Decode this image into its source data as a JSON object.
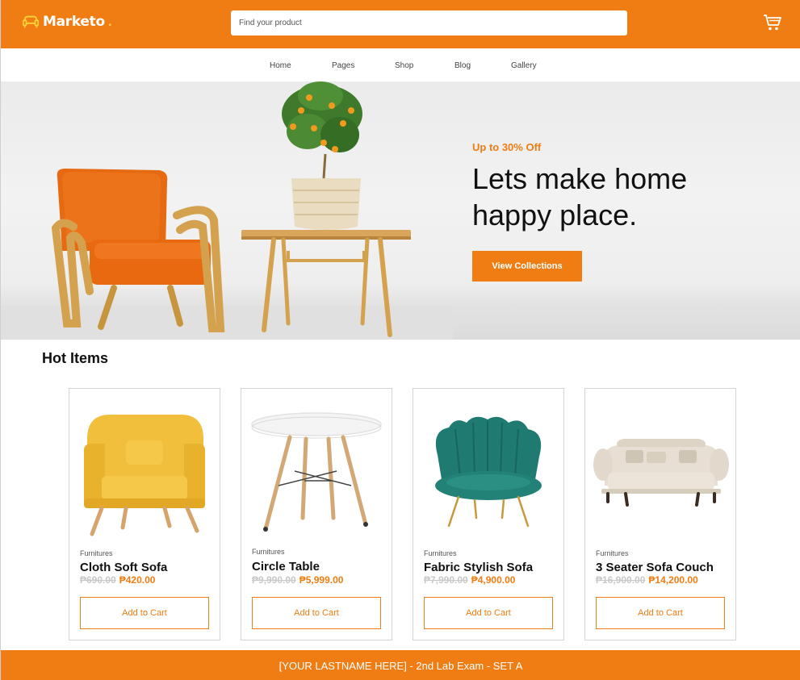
{
  "header": {
    "brand": "Marketo",
    "brand_dot": ".",
    "search_placeholder": "Find your product"
  },
  "nav": {
    "items": [
      "Home",
      "Pages",
      "Shop",
      "Blog",
      "Gallery"
    ]
  },
  "hero": {
    "promo": "Up to 30% Off",
    "title": "Lets make home happy place.",
    "button": "View Collections"
  },
  "hot_items": {
    "title": "Hot Items",
    "products": [
      {
        "category": "Furnitures",
        "name": "Cloth Soft Sofa",
        "old_price": "₱690.00",
        "price": "₱420.00",
        "button": "Add to Cart"
      },
      {
        "category": "Furnitures",
        "name": "Circle Table",
        "old_price": "₱9,990.00",
        "price": "₱5,999.00",
        "button": "Add to Cart"
      },
      {
        "category": "Furnitures",
        "name": "Fabric Stylish Sofa",
        "old_price": "₱7,990.00",
        "price": "₱4,900.00",
        "button": "Add to Cart"
      },
      {
        "category": "Furnitures",
        "name": "3 Seater Sofa Couch",
        "old_price": "₱16,900.00",
        "price": "₱14,200.00",
        "button": "Add to Cart"
      }
    ]
  },
  "footer": {
    "text": "[YOUR LASTNAME HERE] - 2nd Lab Exam - SET A"
  },
  "colors": {
    "accent": "#ef7d13",
    "brand_dot": "#ffd23a"
  },
  "icons": [
    "sofa-logo-icon",
    "cart-icon"
  ]
}
